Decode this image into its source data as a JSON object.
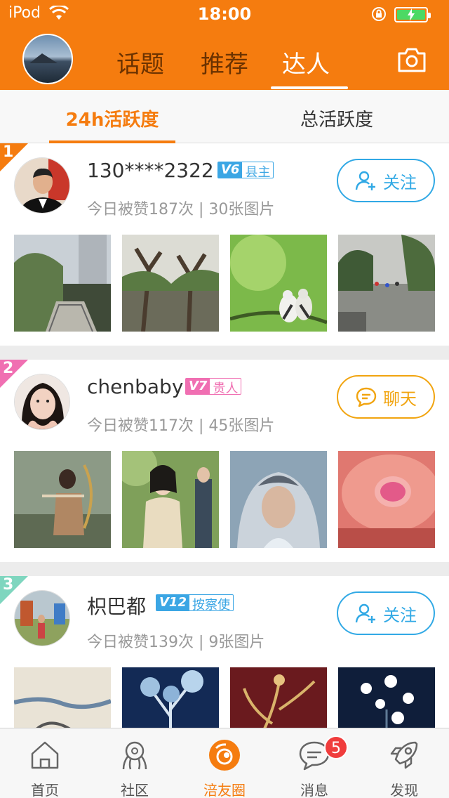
{
  "status_bar": {
    "carrier": "iPod",
    "time": "18:00"
  },
  "header": {
    "tabs": [
      "话题",
      "推荐",
      "达人"
    ],
    "active_tab": "达人"
  },
  "subtabs": {
    "items": [
      "24h活跃度",
      "总活跃度"
    ],
    "active": "24h活跃度"
  },
  "colors": {
    "brand": "#f57c0f",
    "follow": "#31a9e5",
    "chat": "#f1a40f",
    "rank1": "#f57c0f",
    "rank2": "#f06fb2",
    "rank3": "#7fd6bf"
  },
  "users": [
    {
      "rank": "1",
      "name": "130****2322",
      "level": "V6",
      "title": "县主",
      "stats": "今日被赞187次 | 30张图片",
      "action": "关注"
    },
    {
      "rank": "2",
      "name": "chenbaby",
      "level": "V7",
      "title": "贵人",
      "stats": "今日被赞117次 | 45张图片",
      "action": "聊天"
    },
    {
      "rank": "3",
      "name": "枳巴都",
      "level": "V12",
      "title": "按察使",
      "stats": "今日被赞139次 | 9张图片",
      "action": "关注"
    }
  ],
  "tabbar": {
    "items": [
      "首页",
      "社区",
      "涪友圈",
      "消息",
      "发现"
    ],
    "active": "涪友圈",
    "message_badge": "5"
  }
}
